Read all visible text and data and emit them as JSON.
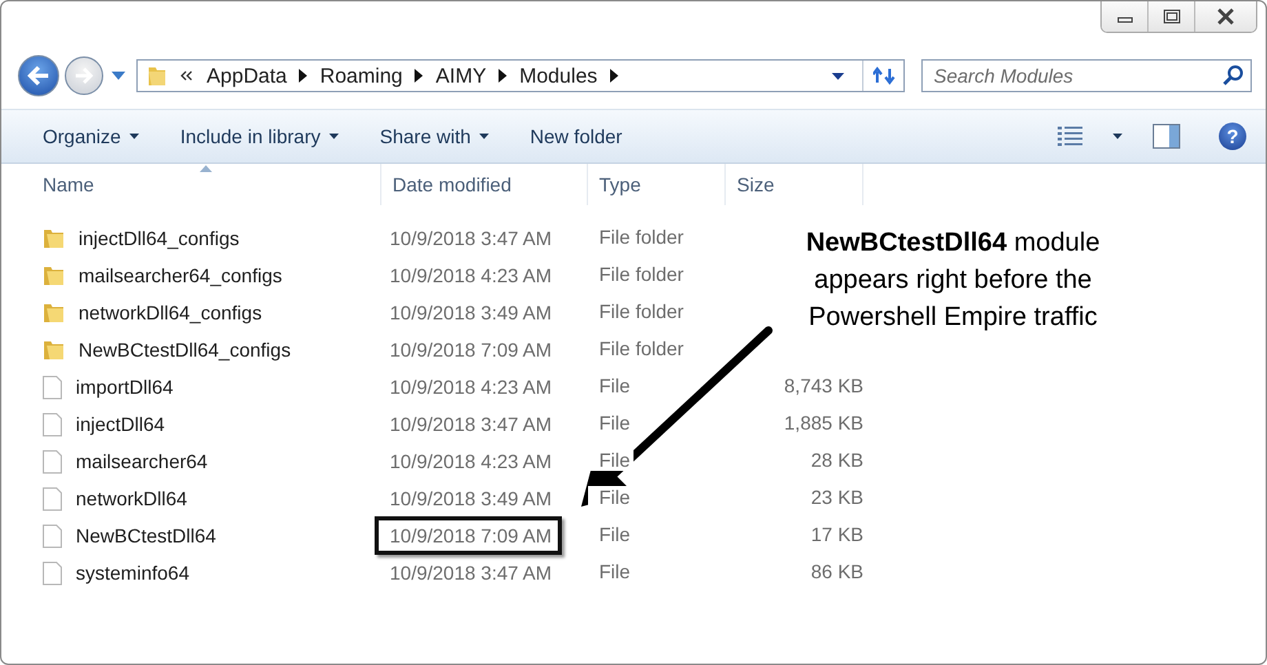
{
  "address_bar": {
    "crumbs": [
      "AppData",
      "Roaming",
      "AIMY",
      "Modules"
    ]
  },
  "search": {
    "placeholder": "Search Modules"
  },
  "toolbar": {
    "buttons": [
      {
        "label": "Organize",
        "dropdown": true
      },
      {
        "label": "Include in library",
        "dropdown": true
      },
      {
        "label": "Share with",
        "dropdown": true
      },
      {
        "label": "New folder",
        "dropdown": false
      }
    ],
    "help_label": "?"
  },
  "columns": [
    {
      "label": "Name",
      "sorted": true
    },
    {
      "label": "Date modified",
      "sorted": false
    },
    {
      "label": "Type",
      "sorted": false
    },
    {
      "label": "Size",
      "sorted": false
    }
  ],
  "rows": [
    {
      "kind": "folder",
      "name": "injectDll64_configs",
      "date": "10/9/2018 3:47 AM",
      "type": "File folder",
      "highlighted": false
    },
    {
      "kind": "folder",
      "name": "mailsearcher64_configs",
      "date": "10/9/2018 4:23 AM",
      "type": "File folder",
      "highlighted": false
    },
    {
      "kind": "folder",
      "name": "networkDll64_configs",
      "date": "10/9/2018 3:49 AM",
      "type": "File folder",
      "highlighted": false
    },
    {
      "kind": "folder",
      "name": "NewBCtestDll64_configs",
      "date": "10/9/2018 7:09 AM",
      "type": "File folder",
      "highlighted": false
    },
    {
      "kind": "file",
      "name": "importDll64",
      "date": "10/9/2018 4:23 AM",
      "type": "File",
      "size": "8,743 KB",
      "highlighted": false
    },
    {
      "kind": "file",
      "name": "injectDll64",
      "date": "10/9/2018 3:47 AM",
      "type": "File",
      "size": "1,885 KB",
      "highlighted": false
    },
    {
      "kind": "file",
      "name": "mailsearcher64",
      "date": "10/9/2018 4:23 AM",
      "type": "File",
      "size": "28 KB",
      "highlighted": false
    },
    {
      "kind": "file",
      "name": "networkDll64",
      "date": "10/9/2018 3:49 AM",
      "type": "File",
      "size": "23 KB",
      "highlighted": false
    },
    {
      "kind": "file",
      "name": "NewBCtestDll64",
      "date": "10/9/2018 7:09 AM",
      "type": "File",
      "size": "17 KB",
      "highlighted": true
    },
    {
      "kind": "file",
      "name": "systeminfo64",
      "date": "10/9/2018 3:47 AM",
      "type": "File",
      "size": "86 KB",
      "highlighted": false
    }
  ],
  "annotation": {
    "text": "**NewBCtestDll64** module appears right before the Powershell Empire traffic"
  }
}
